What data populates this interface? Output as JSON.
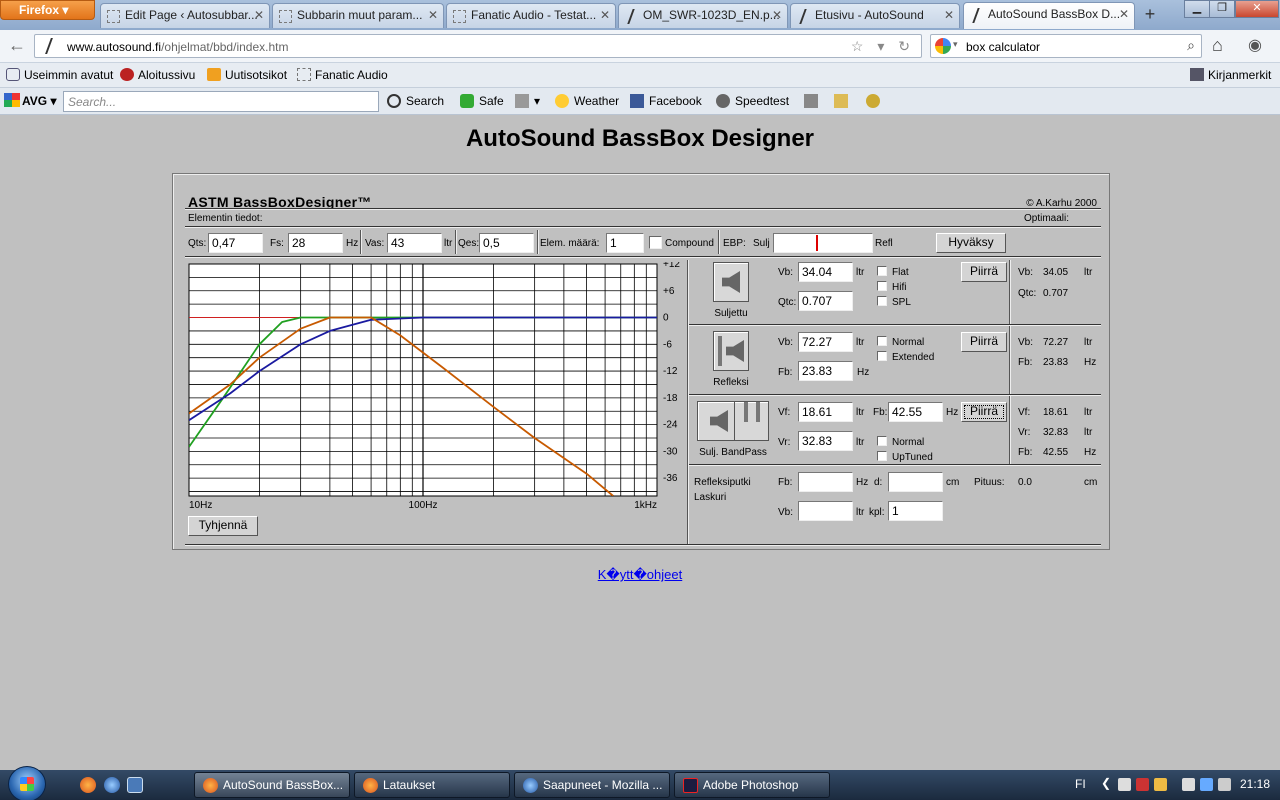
{
  "browser": {
    "menu_label": "Firefox",
    "tabs": [
      {
        "title": "Edit Page ‹ Autosubbar..."
      },
      {
        "title": "Subbarin muut param..."
      },
      {
        "title": "Fanatic Audio - Testat..."
      },
      {
        "title": "OM_SWR-1023D_EN.p..."
      },
      {
        "title": "Etusivu - AutoSound"
      },
      {
        "title": "AutoSound BassBox D..."
      }
    ],
    "url_domain": "www.autosound.fi",
    "url_path": "/ohjelmat/bbd/index.htm",
    "search_value": "box calculator",
    "bookmarks": [
      "Useimmin avatut",
      "Aloitussivu",
      "Uutisotsikot",
      "Fanatic Audio"
    ],
    "bookmarks_menu": "Kirjanmerkit",
    "avg": {
      "logo": "AVG",
      "search_placeholder": "Search...",
      "search_button": "Search",
      "safe": "Safe",
      "weather": "Weather",
      "facebook": "Facebook",
      "speedtest": "Speedtest"
    }
  },
  "page": {
    "title": "AutoSound BassBox Designer",
    "help_link": "K�ytt�ohjeet"
  },
  "app": {
    "title": "ASTM BassBoxDesigner™",
    "copyright": "© A.Karhu 2000",
    "elem_heading": "Elementin tiedot:",
    "optimal_heading": "Optimaali:",
    "params": {
      "qts_label": "Qts:",
      "qts": "0,47",
      "fs_label": "Fs:",
      "fs": "28",
      "fs_unit": "Hz",
      "vas_label": "Vas:",
      "vas": "43",
      "vas_unit": "ltr",
      "qes_label": "Qes:",
      "qes": "0,5",
      "elem_count_label": "Elem. määrä:",
      "elem_count": "1",
      "compound_label": "Compound",
      "ebp_label": "EBP:",
      "ebp_sulj": "Sulj",
      "ebp_refl": "Refl",
      "accept_button": "Hyväksy"
    },
    "clear_button": "Tyhjennä",
    "closed": {
      "name": "Suljettu",
      "vb_label": "Vb:",
      "vb": "34.04",
      "vb_unit": "ltr",
      "qtc_label": "Qtc:",
      "qtc": "0.707",
      "options": [
        "Flat",
        "Hifi",
        "SPL"
      ],
      "draw_button": "Piirrä",
      "opt_vb_label": "Vb:",
      "opt_vb": "34.05",
      "opt_vb_unit": "ltr",
      "opt_qtc_label": "Qtc:",
      "opt_qtc": "0.707"
    },
    "reflex": {
      "name": "Refleksi",
      "vb_label": "Vb:",
      "vb": "72.27",
      "vb_unit": "ltr",
      "fb_label": "Fb:",
      "fb": "23.83",
      "fb_unit": "Hz",
      "options": [
        "Normal",
        "Extended"
      ],
      "draw_button": "Piirrä",
      "opt_vb_label": "Vb:",
      "opt_vb": "72.27",
      "opt_vb_unit": "ltr",
      "opt_fb_label": "Fb:",
      "opt_fb": "23.83",
      "opt_fb_unit": "Hz"
    },
    "bandpass": {
      "name": "Sulj. BandPass",
      "vf_label": "Vf:",
      "vf": "18.61",
      "vf_unit": "ltr",
      "fb_label": "Fb:",
      "fb": "42.55",
      "fb_unit": "Hz",
      "vr_label": "Vr:",
      "vr": "32.83",
      "vr_unit": "ltr",
      "options": [
        "Normal",
        "UpTuned"
      ],
      "draw_button": "Piirrä",
      "opt_vf_label": "Vf:",
      "opt_vf": "18.61",
      "opt_vf_unit": "ltr",
      "opt_vr_label": "Vr:",
      "opt_vr": "32.83",
      "opt_vr_unit": "ltr",
      "opt_fb_label": "Fb:",
      "opt_fb": "42.55",
      "opt_fb_unit": "Hz"
    },
    "port_calc": {
      "title_line1": "Refleksiputki",
      "title_line2": "Laskuri",
      "fb_label": "Fb:",
      "fb": "",
      "fb_unit": "Hz",
      "d_label": "d:",
      "d": "",
      "d_unit": "cm",
      "length_label": "Pituus:",
      "length": "0.0",
      "length_unit": "cm",
      "vb_label": "Vb:",
      "vb": "",
      "vb_unit": "ltr",
      "kpl_label": "kpl:",
      "kpl": "1"
    }
  },
  "chart_data": {
    "type": "line",
    "x_scale": "log",
    "xlim": [
      10,
      1000
    ],
    "ylim": [
      -40,
      12
    ],
    "x_tick_labels": [
      "10Hz",
      "100Hz",
      "1kHz"
    ],
    "y_tick_labels": [
      "+12",
      "+6",
      "0",
      "-6",
      "-12",
      "-18",
      "-24",
      "-30",
      "-36"
    ],
    "grid": true,
    "reference_line": {
      "y": 0,
      "color": "#d02020"
    },
    "series": [
      {
        "color": "#20a020",
        "points": [
          [
            10,
            -29
          ],
          [
            14,
            -18
          ],
          [
            20,
            -6
          ],
          [
            25,
            -1
          ],
          [
            30,
            0
          ],
          [
            1000,
            0
          ]
        ]
      },
      {
        "color": "#1a1aa0",
        "points": [
          [
            10,
            -23
          ],
          [
            15,
            -17
          ],
          [
            20,
            -12
          ],
          [
            30,
            -6
          ],
          [
            40,
            -3
          ],
          [
            60,
            -0.5
          ],
          [
            100,
            0
          ],
          [
            1000,
            0
          ]
        ]
      },
      {
        "color": "#c85a00",
        "points": [
          [
            10,
            -21.5
          ],
          [
            15,
            -15
          ],
          [
            20,
            -9
          ],
          [
            30,
            -2.5
          ],
          [
            40,
            0
          ],
          [
            60,
            0
          ],
          [
            80,
            -4
          ],
          [
            120,
            -11
          ],
          [
            200,
            -20
          ],
          [
            300,
            -27
          ],
          [
            500,
            -35
          ],
          [
            650,
            -40
          ]
        ]
      }
    ]
  },
  "taskbar": {
    "tasks": [
      "AutoSound BassBox...",
      "Lataukset",
      "Saapuneet - Mozilla ...",
      "Adobe Photoshop"
    ],
    "language": "FI",
    "clock": "21:18"
  }
}
